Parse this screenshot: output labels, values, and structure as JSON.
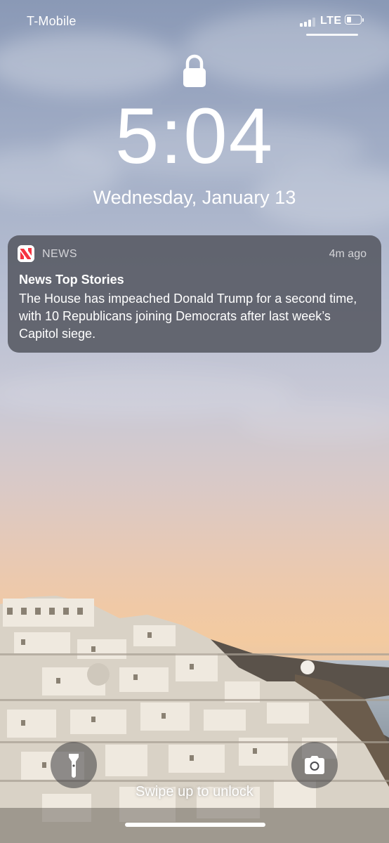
{
  "status_bar": {
    "carrier": "T-Mobile",
    "network": "LTE",
    "signal_bars_active": 3,
    "signal_bars_total": 4,
    "battery_level_fraction": 0.2
  },
  "lock_screen": {
    "time": "5:04",
    "date": "Wednesday, January 13",
    "swipe_hint": "Swipe up to unlock"
  },
  "notification": {
    "app_name": "NEWS",
    "app_icon": "apple-news-icon",
    "timestamp": "4m ago",
    "title": "News Top Stories",
    "body": "The House has impeached Donald Trump for a second time, with 10 Republicans joining Democrats after last week’s Capitol siege."
  },
  "quick_actions": {
    "left_icon": "flashlight-icon",
    "right_icon": "camera-icon"
  },
  "colors": {
    "news_red": "#f5333f",
    "notification_bg": "#545660",
    "sky_top": "#8a99b6",
    "sunset": "#f3caa0"
  }
}
